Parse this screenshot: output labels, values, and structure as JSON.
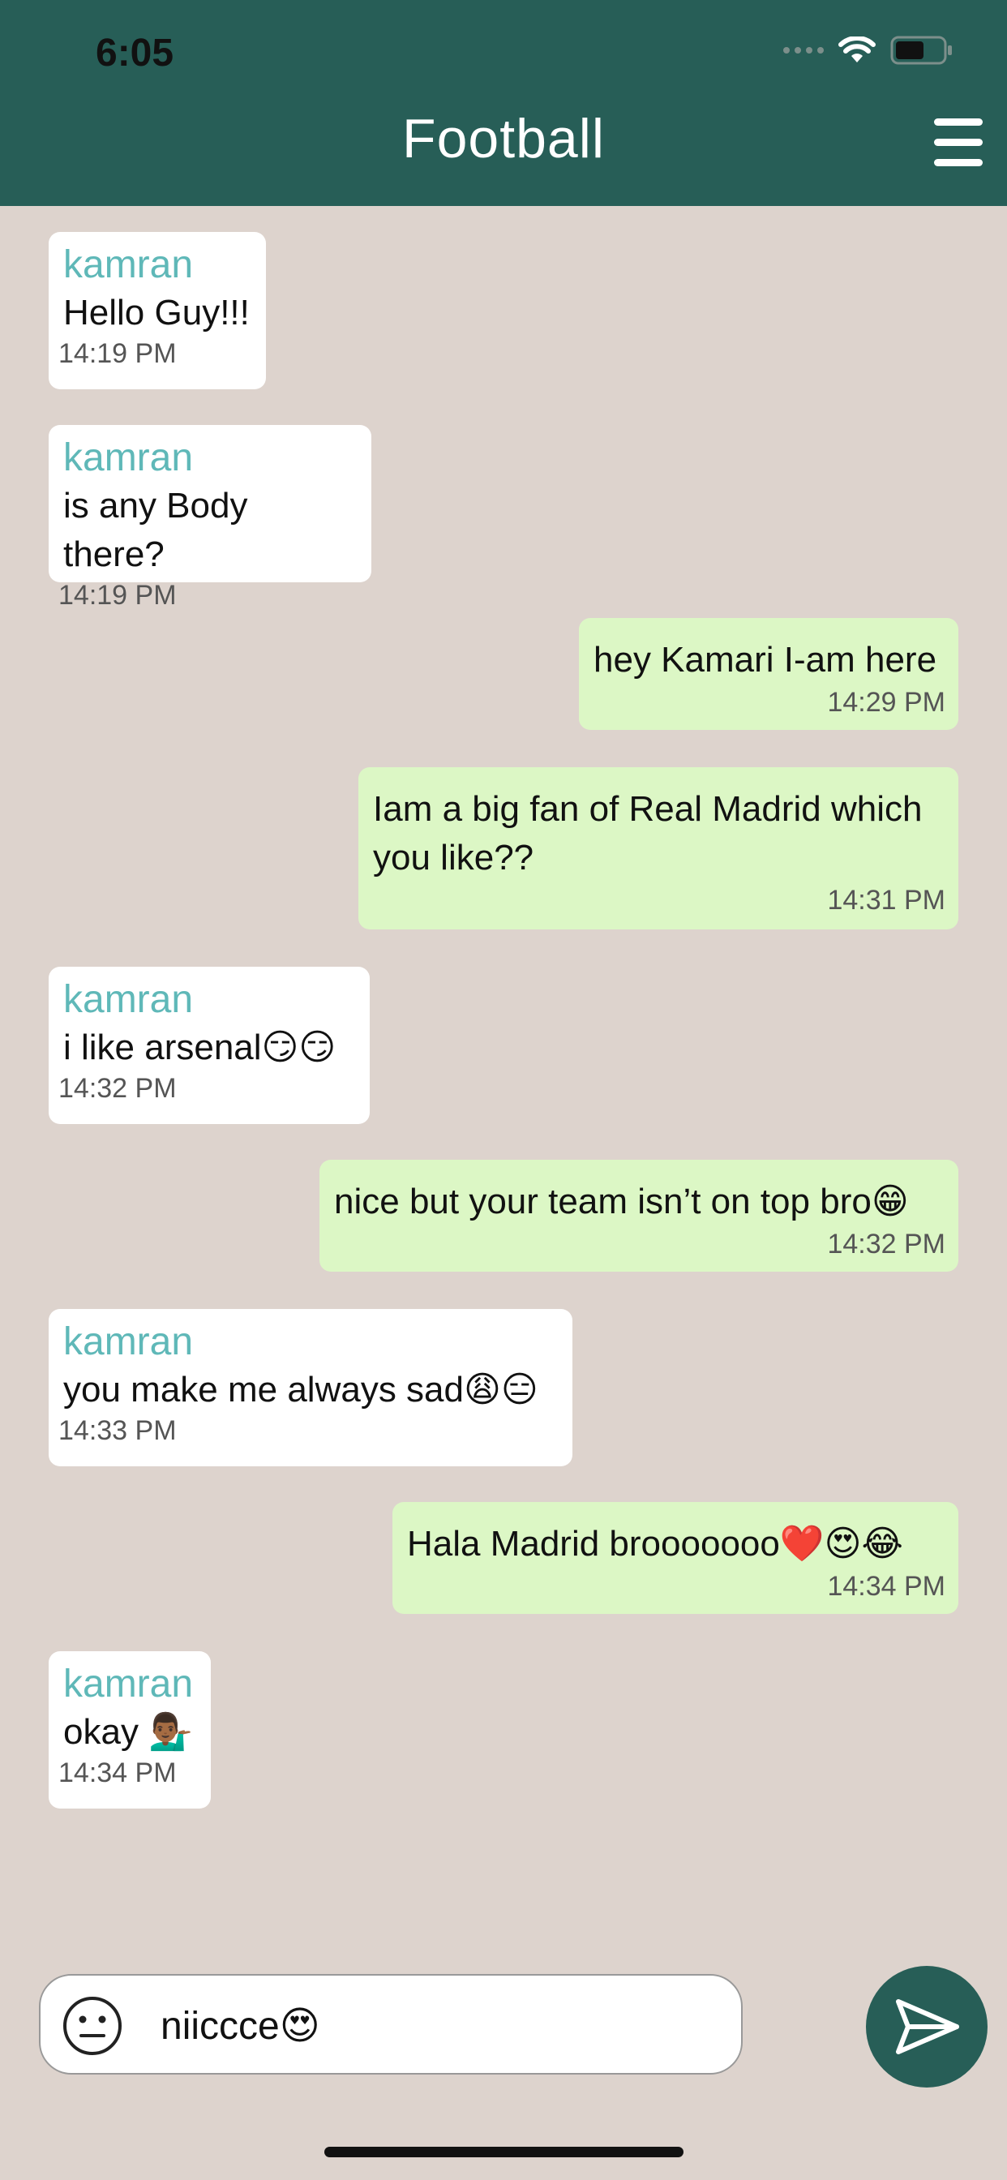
{
  "status": {
    "time": "6:05"
  },
  "header": {
    "title": "Football"
  },
  "messages": [
    {
      "sender": "kamran",
      "text": "Hello Guy!!!",
      "time": "14:19 PM"
    },
    {
      "sender": "kamran",
      "text": "is any Body there?",
      "time": "14:19 PM"
    },
    {
      "text": "hey Kamari I-am here",
      "time": "14:29 PM"
    },
    {
      "text_line1": "Iam a big fan of Real Madrid which",
      "text_line2": "you like??",
      "time": "14:31 PM"
    },
    {
      "sender": "kamran",
      "text": "i like arsenal😏😏",
      "time": "14:32 PM"
    },
    {
      "text": "nice but your team isn’t on top bro😁",
      "time": "14:32 PM"
    },
    {
      "sender": "kamran",
      "text": "you make me always sad😩😑",
      "time": "14:33 PM"
    },
    {
      "text": "Hala Madrid brooooooo❤️😍😂",
      "time": "14:34 PM"
    },
    {
      "sender": "kamran",
      "text": "okay 💁🏾‍♂️",
      "time": "14:34 PM"
    }
  ],
  "composer": {
    "value": "niiccce😍"
  },
  "icons": {
    "menu": "hamburger-menu-icon",
    "emoji": "neutral-face-icon",
    "send": "paper-plane-send-icon"
  },
  "colors": {
    "header": "#275E57",
    "background": "#DDD3CD",
    "incoming": "#FFFFFF",
    "outgoing": "#DCF7C5",
    "sender": "#5FB8B8"
  }
}
